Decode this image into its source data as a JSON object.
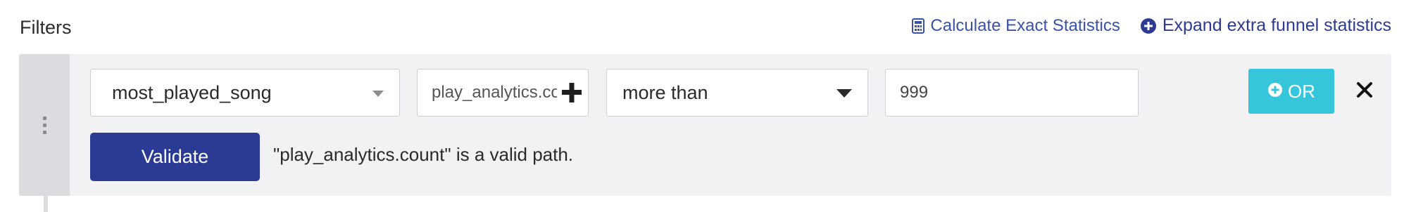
{
  "header": {
    "title": "Filters",
    "calculate_link": "Calculate Exact Statistics",
    "expand_link": "Expand extra funnel statistics"
  },
  "filter": {
    "key_select": "most_played_song",
    "path_value": "play_analytics.count",
    "operator_select": "more than",
    "value": "999",
    "or_button": "OR",
    "validate_button": "Validate",
    "validation_message": "\"play_analytics.count\" is a valid path."
  },
  "colors": {
    "accent_blue": "#2b3a93",
    "or_teal": "#36c6dc",
    "panel_bg": "#f2f2f4"
  },
  "icons": {
    "calculate": "calculator-icon",
    "expand": "plus-circle-icon",
    "path_add": "plus-icon",
    "or_add": "plus-circle-icon",
    "remove": "close-icon",
    "drag": "drag-handle-icon"
  }
}
